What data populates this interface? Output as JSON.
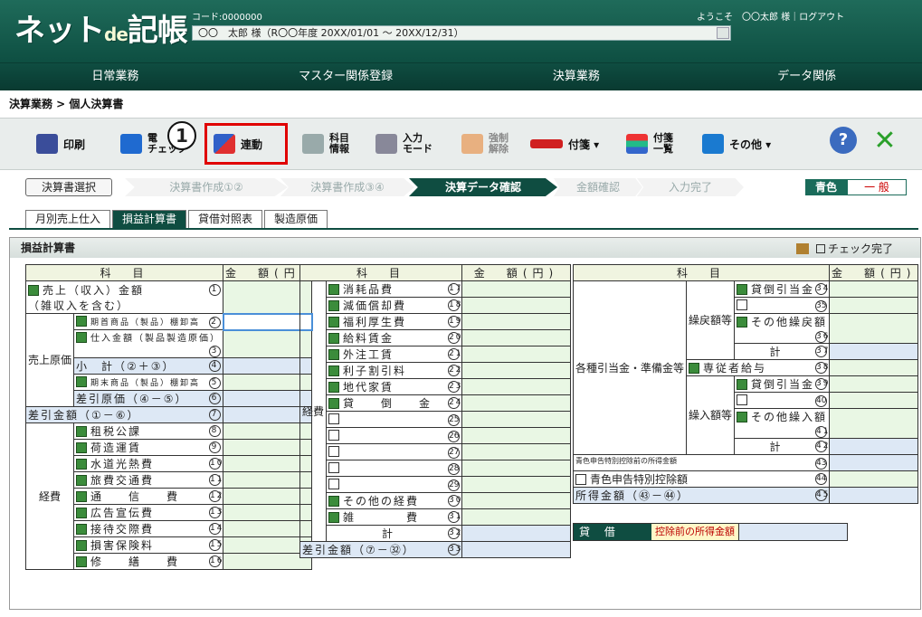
{
  "header": {
    "logo_main": "ネット",
    "logo_de": "de",
    "logo_tail": "記帳",
    "code": "コード:0000000",
    "user_line": "〇〇　太郎 様（R〇〇年度 20XX/01/01 ～ 20XX/12/31）",
    "welcome": "ようこそ　〇〇太郎 様｜ログアウト"
  },
  "menu": [
    "日常業務",
    "マスター関係登録",
    "決算業務",
    "データ関係"
  ],
  "breadcrumb": "決算業務 > 個人決算書",
  "toolbar": {
    "print": "印刷",
    "elec1": "電",
    "elec2": "チェック",
    "renkei": "連動",
    "kamoku1": "科目",
    "kamoku2": "情報",
    "input1": "入力",
    "input2": "モード",
    "force1": "強制",
    "force2": "解除",
    "fusen": "付箋 ▾",
    "fusen_list1": "付箋",
    "fusen_list2": "一覧",
    "other": "その他 ▾",
    "help": "?",
    "close": "✕",
    "badge": "1"
  },
  "steps": {
    "select": "決算書選択",
    "s1": "決算書作成①②",
    "s2": "決算書作成③④",
    "s3": "決算データ確認",
    "s4": "金額確認",
    "s5": "入力完了",
    "aoiro": "青色",
    "ippan": "一 般"
  },
  "tabs": [
    "月別売上仕入",
    "損益計算書",
    "貸借対照表",
    "製造原価"
  ],
  "panel": {
    "title": "損益計算書",
    "check": "チェック完了"
  },
  "col": {
    "kamoku": "科　目",
    "kingaku": "金　額",
    "en": "(円)"
  },
  "left_rows": [
    {
      "label": "売上（収入）金額",
      "sub": "（雑収入を含む）",
      "n": "1"
    },
    {
      "label": "期首商品（製品）棚卸高",
      "n": "2"
    },
    {
      "label": "仕入金額（製品製造原価）",
      "n": "3"
    },
    {
      "label": "小　計（②＋③）",
      "n": "4"
    },
    {
      "label": "期末商品（製品）棚卸高",
      "n": "5"
    },
    {
      "label": "差引原価（④－⑤）",
      "n": "6"
    },
    {
      "label": "差引金額（①－⑥）",
      "n": "7"
    },
    {
      "label": "租税公課",
      "n": "8"
    },
    {
      "label": "荷造運賃",
      "n": "9"
    },
    {
      "label": "水道光熱費",
      "n": "10"
    },
    {
      "label": "旅費交通費",
      "n": "11"
    },
    {
      "label": "通　　信　　費",
      "n": "12"
    },
    {
      "label": "広告宣伝費",
      "n": "13"
    },
    {
      "label": "接待交際費",
      "n": "14"
    },
    {
      "label": "損害保険料",
      "n": "15"
    },
    {
      "label": "修　　繕　　費",
      "n": "16"
    }
  ],
  "left_side": {
    "uriage": "売上原価",
    "keihi": "経費"
  },
  "mid_rows": [
    {
      "label": "消耗品費",
      "n": "17"
    },
    {
      "label": "減価償却費",
      "n": "18"
    },
    {
      "label": "福利厚生費",
      "n": "19"
    },
    {
      "label": "給料賃金",
      "n": "20"
    },
    {
      "label": "外注工賃",
      "n": "21"
    },
    {
      "label": "利子割引料",
      "n": "22"
    },
    {
      "label": "地代家賃",
      "n": "23"
    },
    {
      "label": "貸　　倒　　金",
      "n": "24"
    },
    {
      "label": "",
      "n": "25"
    },
    {
      "label": "",
      "n": "26"
    },
    {
      "label": "",
      "n": "27"
    },
    {
      "label": "",
      "n": "28"
    },
    {
      "label": "",
      "n": "29"
    },
    {
      "label": "その他の経費",
      "n": "30"
    },
    {
      "label": "雑　　　　費",
      "n": "31"
    },
    {
      "label": "計",
      "n": "32"
    },
    {
      "label": "差引金額（⑦－㉜）",
      "n": "33"
    }
  ],
  "right_rows": [
    {
      "label": "貸倒引当金",
      "n": "34"
    },
    {
      "label": "",
      "n": "35"
    },
    {
      "label": "その他繰戻額",
      "n": "36"
    },
    {
      "label": "計",
      "n": "37"
    },
    {
      "label": "専従者給与",
      "n": "38"
    },
    {
      "label": "貸倒引当金",
      "n": "39"
    },
    {
      "label": "",
      "n": "40"
    },
    {
      "label": "その他繰入額",
      "n": "41"
    },
    {
      "label": "計",
      "n": "42"
    },
    {
      "label": "青色申告特別控除前の所得金額",
      "n": "43"
    },
    {
      "label": "青色申告特別控除額",
      "n": "44"
    },
    {
      "label": "所得金額（㊸－㊹）",
      "n": "45"
    }
  ],
  "right_side": {
    "a": "各種引当金・準備金等",
    "b": "繰戻額等",
    "c": "繰入額等"
  },
  "kasi": {
    "a": "貸 借",
    "b": "控除前の所得金額"
  }
}
